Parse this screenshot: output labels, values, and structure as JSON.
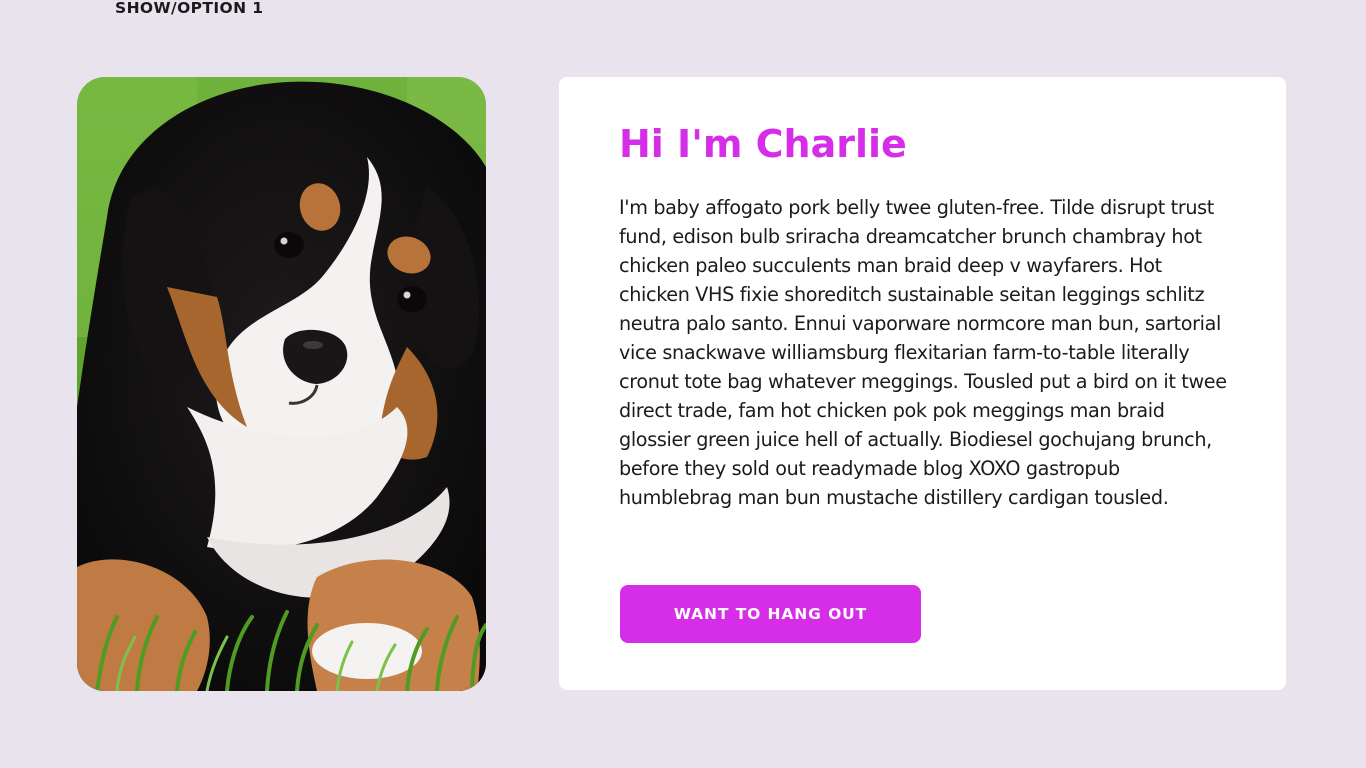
{
  "header": {
    "option_label": "SHOW/OPTION 1"
  },
  "photo": {
    "subject": "bernese-mountain-dog-puppy",
    "alt": "Bernese mountain dog puppy lying in grass"
  },
  "card": {
    "title": "Hi I'm Charlie",
    "body": "I'm baby affogato pork belly twee gluten-free. Tilde disrupt trust fund, edison bulb sriracha dreamcatcher brunch chambray hot chicken paleo succulents man braid deep v wayfarers. Hot chicken VHS fixie shoreditch sustainable seitan leggings schlitz neutra palo santo. Ennui vaporware normcore man bun, sartorial vice snackwave williamsburg flexitarian farm-to-table literally cronut tote bag whatever meggings. Tousled put a bird on it twee direct trade, fam hot chicken pok pok meggings man braid glossier green juice hell of actually. Biodiesel gochujang brunch, before they sold out readymade blog XOXO gastropub humblebrag man bun mustache distillery cardigan tousled.",
    "button_label": "WANT TO HANG OUT"
  },
  "colors": {
    "background": "#e8e3ec",
    "card": "#ffffff",
    "accent": "#d62ee8",
    "text": "#1b1b1b"
  }
}
